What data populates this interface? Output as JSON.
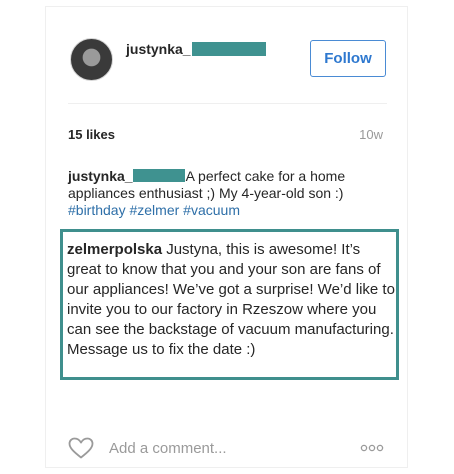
{
  "post": {
    "username": "justynka_",
    "follow_label": "Follow",
    "likes": "15 likes",
    "time_ago": "10w",
    "caption": {
      "username": "justynka_",
      "text": "A perfect cake for a home appliances enthusiast ;) My 4-year-old son :)",
      "hashtags": [
        "#birthday",
        "#zelmer",
        "#vacuum"
      ]
    },
    "reply": {
      "username": "zelmerpolska",
      "text": "Justyna, this is awesome! It’s great to know that you and your son are fans of our appliances! We’ve got a surprise! We’d like to invite you to our factory in Rzeszow where you can see the backstage of vacuum manufacturing. Message us to fix the date :)"
    },
    "comment_placeholder": "Add a comment..."
  },
  "colors": {
    "accent_blue": "#2e78cf",
    "hashtag": "#2e6fa8",
    "redaction_teal": "#3f9290",
    "reply_border": "#3f8f8d"
  },
  "icons": [
    "heart-icon",
    "more-icon"
  ]
}
